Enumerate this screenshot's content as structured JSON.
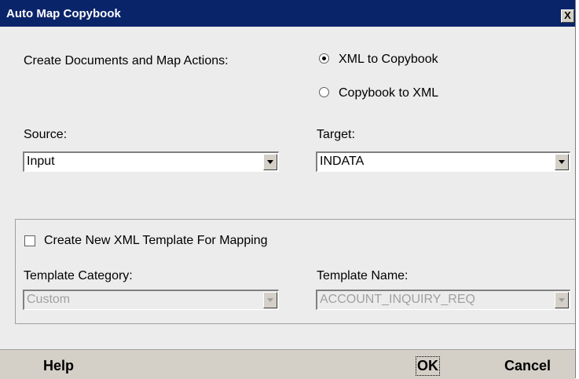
{
  "window": {
    "title": "Auto Map Copybook",
    "close_label": "X"
  },
  "map_actions": {
    "label": "Create Documents and Map Actions:",
    "options": [
      {
        "label": "XML to Copybook",
        "selected": true
      },
      {
        "label": "Copybook to XML",
        "selected": false
      }
    ]
  },
  "source": {
    "label": "Source:",
    "value": "Input"
  },
  "target": {
    "label": "Target:",
    "value": "INDATA"
  },
  "template": {
    "checkbox_label": "Create New XML Template For Mapping",
    "checked": false,
    "category_label": "Template Category:",
    "category_value": "Custom",
    "name_label": "Template Name:",
    "name_value": "ACCOUNT_INQUIRY_REQ"
  },
  "buttons": {
    "help": "Help",
    "ok": "OK",
    "cancel": "Cancel"
  }
}
